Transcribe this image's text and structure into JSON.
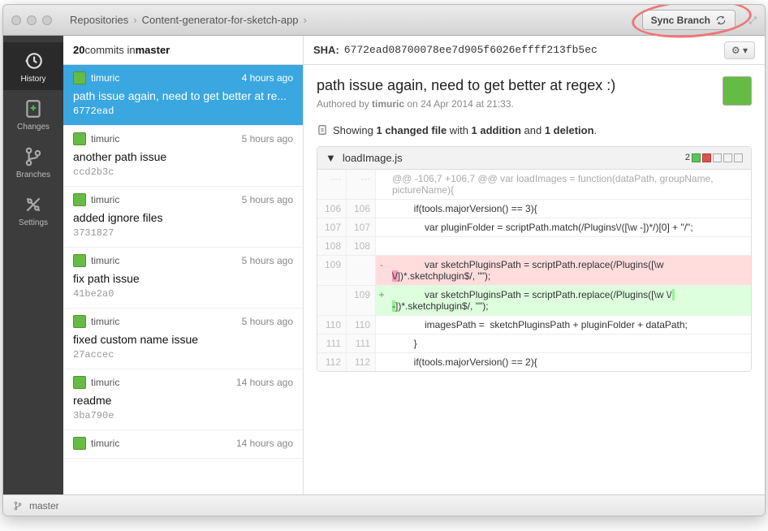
{
  "breadcrumbs": [
    "Repositories",
    "Content-generator-for-sketch-app"
  ],
  "sync_button": "Sync Branch",
  "sidebar": {
    "items": [
      {
        "label": "History"
      },
      {
        "label": "Changes"
      },
      {
        "label": "Branches"
      },
      {
        "label": "Settings"
      }
    ]
  },
  "commits_header": {
    "count": "20",
    "mid": " commits in ",
    "branch": "master"
  },
  "commits": [
    {
      "author": "timuric",
      "time": "4 hours ago",
      "msg": "path issue again, need to get better at re...",
      "sha": "6772ead",
      "selected": true
    },
    {
      "author": "timuric",
      "time": "5 hours ago",
      "msg": "another path issue",
      "sha": "ccd2b3c"
    },
    {
      "author": "timuric",
      "time": "5 hours ago",
      "msg": "added ignore files",
      "sha": "3731827"
    },
    {
      "author": "timuric",
      "time": "5 hours ago",
      "msg": "fix path issue",
      "sha": "41be2a0"
    },
    {
      "author": "timuric",
      "time": "5 hours ago",
      "msg": "fixed custom name issue",
      "sha": "27accec"
    },
    {
      "author": "timuric",
      "time": "14 hours ago",
      "msg": "readme",
      "sha": "3ba790e"
    },
    {
      "author": "timuric",
      "time": "14 hours ago",
      "msg": "",
      "sha": ""
    }
  ],
  "sha_bar": {
    "label": "SHA:",
    "value": "6772ead08700078ee7d905f6026effff213fb5ec"
  },
  "detail": {
    "title": "path issue again, need to get better at regex :)",
    "sub_prefix": "Authored by ",
    "sub_author": "timuric",
    "sub_mid": " on ",
    "sub_date": "24 Apr 2014 at 21:33."
  },
  "summary": {
    "prefix": "Showing ",
    "files": "1 changed file",
    "mid1": " with ",
    "adds": "1 addition",
    "mid2": " and ",
    "dels": "1 deletion",
    "suffix": "."
  },
  "file": {
    "name": "loadImage.js",
    "count": "2"
  },
  "diff": {
    "hunk": "@@ -106,7 +106,7 @@ var loadImages = function(dataPath, groupName, pictureName){",
    "lines": [
      {
        "l": "106",
        "r": "106",
        "s": "",
        "t": "        if(tools.majorVersion() == 3){"
      },
      {
        "l": "107",
        "r": "107",
        "s": "",
        "t": "            var pluginFolder = scriptPath.match(/Plugins\\/([\\w -])*/)[0] + \"/\";"
      },
      {
        "l": "108",
        "r": "108",
        "s": "",
        "t": ""
      },
      {
        "l": "109",
        "r": "",
        "s": "-",
        "t": "            var sketchPluginsPath = scriptPath.replace(/Plugins([\\w \\/])*.sketchplugin$/, \"\");",
        "cls": "del",
        "hl": "\\/"
      },
      {
        "l": "",
        "r": "109",
        "s": "+",
        "t": "            var sketchPluginsPath = scriptPath.replace(/Plugins([\\w \\/ -])*.sketchplugin$/, \"\");",
        "cls": "add",
        "hl": " -"
      },
      {
        "l": "110",
        "r": "110",
        "s": "",
        "t": "            imagesPath =  sketchPluginsPath + pluginFolder + dataPath;"
      },
      {
        "l": "111",
        "r": "111",
        "s": "",
        "t": "        }"
      },
      {
        "l": "112",
        "r": "112",
        "s": "",
        "t": "        if(tools.majorVersion() == 2){"
      }
    ]
  },
  "status": {
    "branch": "master"
  }
}
